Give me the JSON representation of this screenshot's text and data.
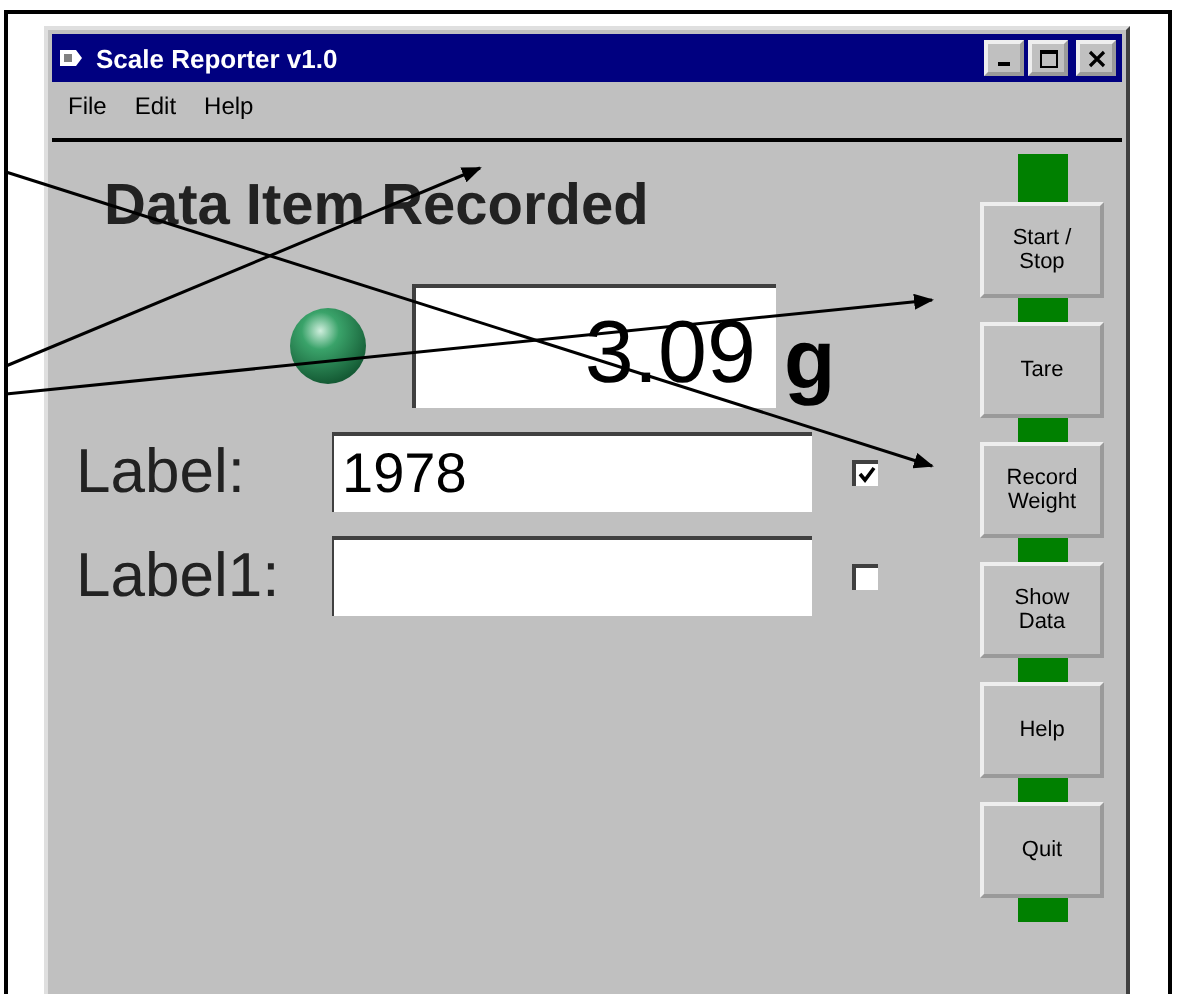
{
  "window": {
    "title": "Scale Reporter v1.0"
  },
  "menu": [
    {
      "label": "File"
    },
    {
      "label": "Edit"
    },
    {
      "label": "Help"
    }
  ],
  "heading": "Data Item Recorded",
  "readout": {
    "value": "3.09",
    "unit": "g"
  },
  "labels": [
    {
      "label": "Label:",
      "value": "1978",
      "checked": true
    },
    {
      "label": "Label1:",
      "checked": false
    }
  ],
  "buttons": [
    {
      "label": "Start /\nStop"
    },
    {
      "label": "Tare"
    },
    {
      "label": "Record\nWeight"
    },
    {
      "label": "Show\nData"
    },
    {
      "label": "Help"
    },
    {
      "label": "Quit"
    }
  ]
}
